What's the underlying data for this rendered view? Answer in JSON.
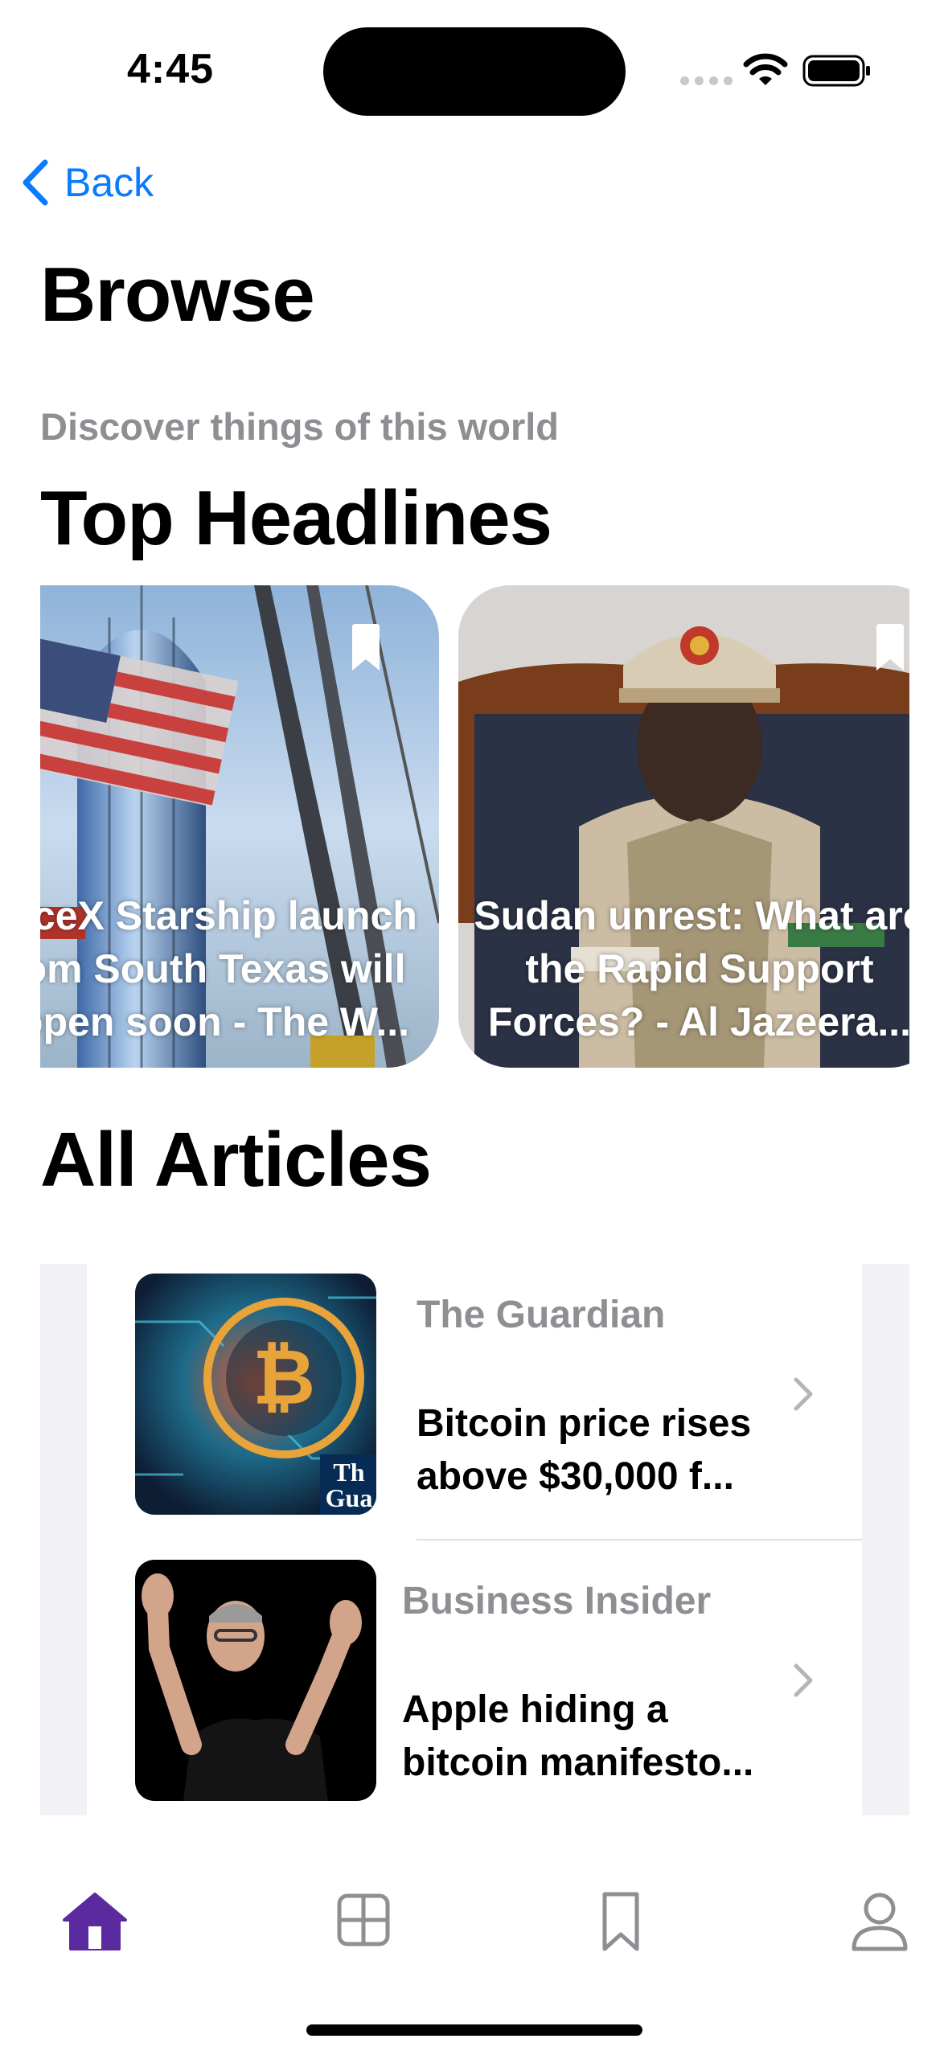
{
  "status_bar": {
    "time": "4:45"
  },
  "nav": {
    "back_label": "Back"
  },
  "page": {
    "title": "Browse",
    "subtitle": "Discover things of this world"
  },
  "top_headlines": {
    "title": "Top Headlines",
    "cards": [
      {
        "caption_lines": [
          "aceX Starship launch",
          "om South Texas will",
          "open soon - The W..."
        ]
      },
      {
        "caption_lines": [
          "Sudan unrest: What are",
          "the Rapid Support",
          "Forces? - Al Jazeera..."
        ]
      }
    ]
  },
  "all_articles": {
    "title": "All Articles",
    "items": [
      {
        "source": "The Guardian",
        "title_lines": [
          "Bitcoin price rises",
          "above $30,000 f..."
        ],
        "thumb_text": "The Gua"
      },
      {
        "source": "Business Insider",
        "title_lines": [
          "Apple hiding a",
          "bitcoin manifesto..."
        ]
      }
    ]
  },
  "tabbar": {
    "active_color": "#5b2a9e",
    "inactive_color": "#8e8e93",
    "tabs": [
      "home-icon",
      "grid-icon",
      "bookmark-icon",
      "profile-icon"
    ]
  },
  "colors": {
    "accent": "#0a7aff",
    "secondary_text": "#8e8e93"
  }
}
